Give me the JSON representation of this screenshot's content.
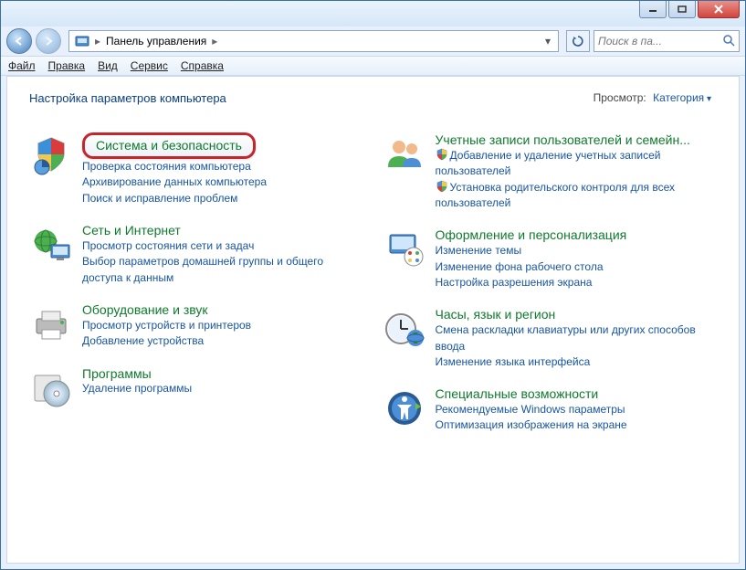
{
  "titlebar": {},
  "nav": {
    "breadcrumb_root": "Панель управления",
    "search_placeholder": "Поиск в па..."
  },
  "menu": {
    "file": "Файл",
    "edit": "Правка",
    "view": "Вид",
    "tools": "Сервис",
    "help": "Справка"
  },
  "page": {
    "heading": "Настройка параметров компьютера",
    "view_label": "Просмотр:",
    "view_value": "Категория"
  },
  "left": [
    {
      "icon": "security-shield",
      "title": "Система и безопасность",
      "highlighted": true,
      "links": [
        {
          "text": "Проверка состояния компьютера"
        },
        {
          "text": "Архивирование данных компьютера"
        },
        {
          "text": "Поиск и исправление проблем"
        }
      ]
    },
    {
      "icon": "network-globe",
      "title": "Сеть и Интернет",
      "links": [
        {
          "text": "Просмотр состояния сети и задач"
        },
        {
          "text": "Выбор параметров домашней группы и общего доступа к данным"
        }
      ]
    },
    {
      "icon": "hardware-printer",
      "title": "Оборудование и звук",
      "links": [
        {
          "text": "Просмотр устройств и принтеров"
        },
        {
          "text": "Добавление устройства"
        }
      ]
    },
    {
      "icon": "programs-disc",
      "title": "Программы",
      "links": [
        {
          "text": "Удаление программы"
        }
      ]
    }
  ],
  "right": [
    {
      "icon": "user-accounts",
      "title": "Учетные записи пользователей и семейн...",
      "links": [
        {
          "text": "Добавление и удаление учетных записей пользователей",
          "shield": true
        },
        {
          "text": "Установка родительского контроля для всех пользователей",
          "shield": true
        }
      ]
    },
    {
      "icon": "appearance",
      "title": "Оформление и персонализация",
      "links": [
        {
          "text": "Изменение темы"
        },
        {
          "text": "Изменение фона рабочего стола"
        },
        {
          "text": "Настройка разрешения экрана"
        }
      ]
    },
    {
      "icon": "clock-region",
      "title": "Часы, язык и регион",
      "links": [
        {
          "text": "Смена раскладки клавиатуры или других способов ввода"
        },
        {
          "text": "Изменение языка интерфейса"
        }
      ]
    },
    {
      "icon": "ease-access",
      "title": "Специальные возможности",
      "links": [
        {
          "text": "Рекомендуемые Windows параметры"
        },
        {
          "text": "Оптимизация изображения на экране"
        }
      ]
    }
  ]
}
